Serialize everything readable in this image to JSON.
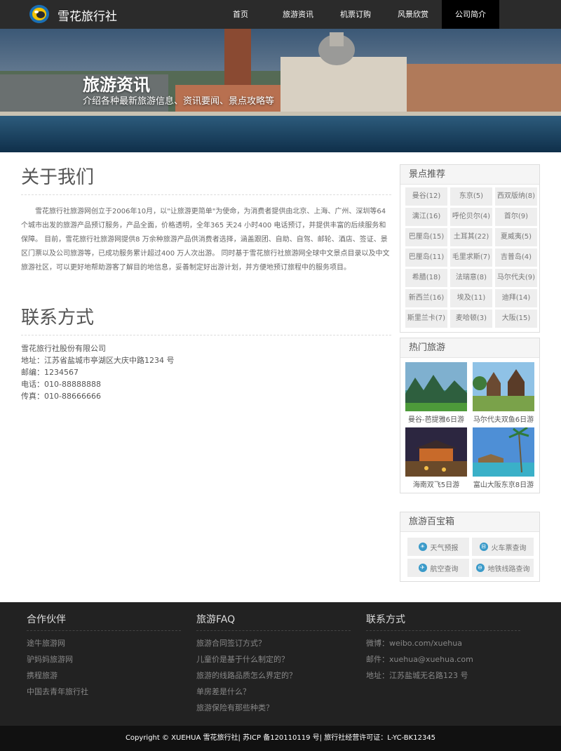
{
  "header": {
    "brand": "雪花旅行社",
    "nav": [
      "首页",
      "旅游资讯",
      "机票订购",
      "风景欣赏",
      "公司简介"
    ],
    "active_index": 4
  },
  "banner": {
    "title": "旅游资讯",
    "subtitle": "介绍各种最新旅游信息、资讯要闻、景点攻略等"
  },
  "about": {
    "title": "关于我们",
    "text": "雪花旅行社旅游网创立于2006年10月，以\"让旅游更简单\"为使命，为消费者提供由北京、上海、广州、深圳等64 个城市出发的旅游产品预订服务，产品全面，价格透明，全年365 天24 小时400 电话预订，并提供丰富的后续服务和保障。 目前，雪花旅行社旅游网提供8 万余种旅游产品供消费者选择，涵盖跟团、自助、自驾、邮轮、酒店、签证、景区门票以及公司旅游等，已成功服务累计超过400 万人次出游。 同时基于雪花旅行社旅游网全球中文景点目录以及中文旅游社区，可以更好地帮助游客了解目的地信息，妥善制定好出游计划，并方便地预订旅程中的服务项目。"
  },
  "contact": {
    "title": "联系方式",
    "lines": [
      "雪花旅行社股份有限公司",
      "地址：江苏省盐城市亭湖区大庆中路1234 号",
      "邮编：1234567",
      "电话：010-88888888",
      "传真：010-88666666"
    ]
  },
  "sidebar": {
    "spots": {
      "title": "景点推荐",
      "tags": [
        "曼谷(12)",
        "东京(5)",
        "西双版纳(8)",
        "漓江(16)",
        "呼伦贝尔(4)",
        "首尔(9)",
        "巴厘岛(15)",
        "土耳其(22)",
        "夏威夷(5)",
        "巴厘岛(11)",
        "毛里求斯(7)",
        "吉普岛(4)",
        "希腊(18)",
        "法瑞意(8)",
        "马尔代夫(9)",
        "新西兰(16)",
        "埃及(11)",
        "迪拜(14)",
        "斯里兰卡(7)",
        "麦哈顿(3)",
        "大阪(15)"
      ]
    },
    "hot": {
      "title": "热门旅游",
      "items": [
        "曼谷-芭提雅6日游",
        "马尔代夫双鱼6日游",
        "海南双飞5日游",
        "富山大阪东京8日游"
      ]
    },
    "tools": {
      "title": "旅游百宝箱",
      "items": [
        {
          "label": "天气预报",
          "icon": "weather-icon",
          "glyph": "☀"
        },
        {
          "label": "火车票查询",
          "icon": "train-icon",
          "glyph": "⊟"
        },
        {
          "label": "航空查询",
          "icon": "plane-icon",
          "glyph": "✈"
        },
        {
          "label": "地铁线路查询",
          "icon": "subway-icon",
          "glyph": "⊖"
        }
      ]
    }
  },
  "footer": {
    "partners": {
      "title": "合作伙伴",
      "items": [
        "途牛旅游网",
        "驴妈妈旅游网",
        "携程旅游",
        "中国去青年旅行社"
      ]
    },
    "faq": {
      "title": "旅游FAQ",
      "items": [
        "旅游合同签订方式？",
        "儿童价是基于什么制定的？",
        "旅游的线路品质怎么界定的？",
        "单房差是什么？",
        "旅游保险有那些种类？"
      ]
    },
    "contact": {
      "title": "联系方式",
      "items": [
        "微博：weibo.com/xuehua",
        "邮件：xuehua@xuehua.com",
        "地址：江苏盐城无名路123 号"
      ]
    },
    "copyright": "Copyright © XUEHUA 雪花旅行社| 苏ICP 备120110119 号| 旅行社经营许可证：L-YC-BK12345"
  },
  "colors": {
    "header_bg": "#2b2b2b",
    "nav_active_bg": "#000000",
    "footer_bg": "#222222",
    "tool_icon": "#3a9ac9"
  }
}
